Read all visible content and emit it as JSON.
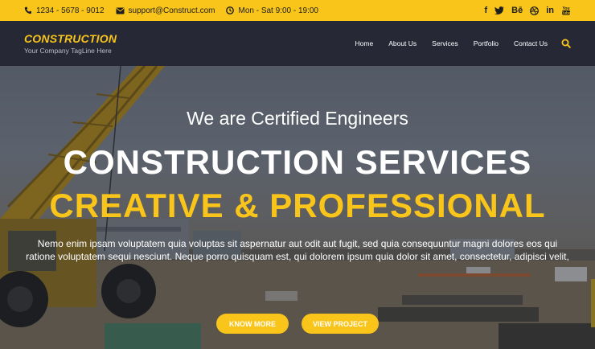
{
  "topbar": {
    "phone": "1234 - 5678 - 9012",
    "email": "support@Construct.com",
    "hours": "Mon - Sat 9:00 - 19:00",
    "socials": [
      {
        "icon": "facebook-icon",
        "glyph": "f"
      },
      {
        "icon": "twitter-icon",
        "glyph": "t"
      },
      {
        "icon": "behance-icon",
        "glyph": "Bē"
      },
      {
        "icon": "dribbble-icon",
        "glyph": "◎"
      },
      {
        "icon": "linkedin-icon",
        "glyph": "in"
      },
      {
        "icon": "youtube-icon",
        "glyph": "You"
      }
    ]
  },
  "logo": {
    "name": "CONSTRUCTION",
    "tagline": "Your Company TagLine Here"
  },
  "menu": {
    "home": "Home",
    "about": "About Us",
    "services": "Services",
    "portfolio": "Portfolio",
    "contact": "Contact Us"
  },
  "hero": {
    "subtitle": "We are Certified Engineers",
    "title_line1": "CONSTRUCTION SERVICES",
    "title_line2": "CREATIVE & PROFESSIONAL",
    "description": "Nemo enim ipsam voluptatem quia voluptas sit aspernatur aut odit aut fugit, sed quia consequuntur magni dolores eos qui ratione voluptatem sequi nesciunt. Neque porro quisquam est, qui dolorem ipsum quia dolor sit amet, consectetur, adipisci velit,",
    "button_know_more": "KNOW MORE",
    "button_view_project": "VIEW PROJECT"
  },
  "colors": {
    "accent": "#f9c51a",
    "nav_bg": "#262836",
    "text_white": "#ffffff"
  }
}
